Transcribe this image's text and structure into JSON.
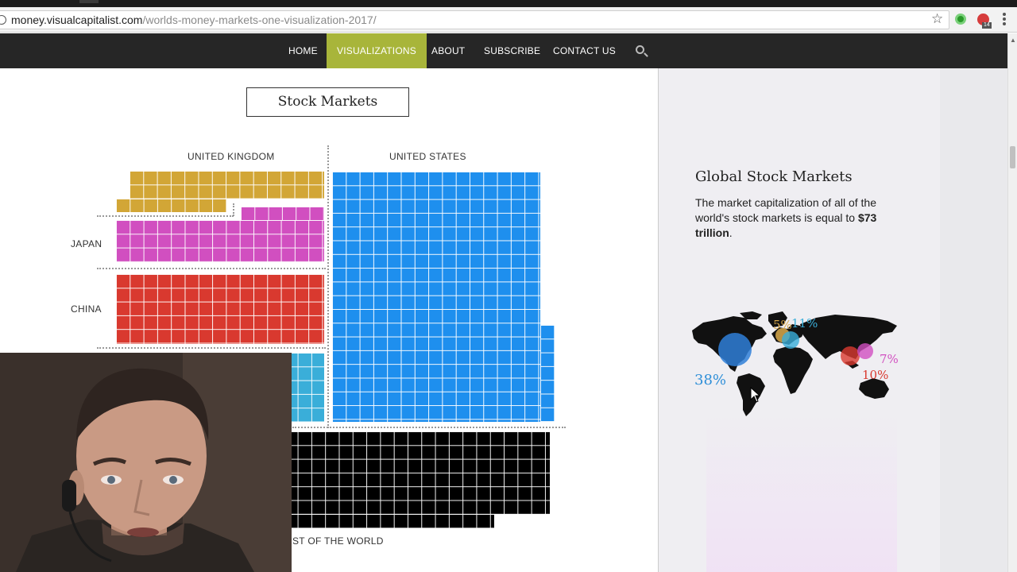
{
  "browser": {
    "url_domain": "money.visualcapitalist.com",
    "url_path": "/worlds-money-markets-one-visualization-2017/",
    "extension_badge": "14",
    "icons": [
      "info-icon",
      "star-icon",
      "ext-green-icon",
      "ext-abp-icon",
      "menu-icon"
    ]
  },
  "nav": {
    "items": [
      {
        "label": "HOME",
        "active": false
      },
      {
        "label": "VISUALIZATIONS",
        "active": true
      },
      {
        "label": "ABOUT",
        "active": false
      },
      {
        "label": "SUBSCRIBE",
        "active": false
      },
      {
        "label": "CONTACT US",
        "active": false
      }
    ],
    "active_color": "#a8b53a",
    "search_icon": "search-icon"
  },
  "main": {
    "section_title": "Stock Markets",
    "regions": {
      "uk": {
        "label": "UNITED KINGDOM",
        "color": "#d2a636"
      },
      "us": {
        "label": "UNITED STATES",
        "color": "#1e8fee"
      },
      "japan": {
        "label": "JAPAN",
        "color": "#d14fc0"
      },
      "china": {
        "label": "CHINA",
        "color": "#d9392f"
      },
      "europe": {
        "color": "#3aaed9"
      },
      "rest": {
        "label": "ST OF THE WORLD",
        "color": "#000000"
      }
    }
  },
  "sidebar": {
    "heading": "Global Stock Markets",
    "text_before": "The market capitalization of all of the world's stock markets is equal to ",
    "text_bold": "$73 trillion",
    "text_after": ".",
    "map_labels": [
      {
        "text": "5%",
        "color": "#d9a94a"
      },
      {
        "text": "11%",
        "color": "#3aaed9"
      },
      {
        "text": "38%",
        "color": "#2f8fd8"
      },
      {
        "text": "7%",
        "color": "#d14fc0"
      },
      {
        "text": "10%",
        "color": "#d9392f"
      }
    ]
  }
}
